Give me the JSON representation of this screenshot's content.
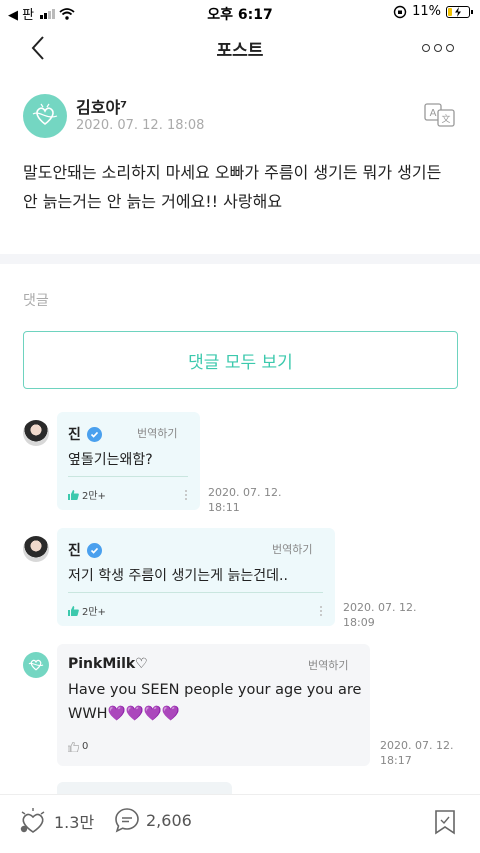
{
  "status_bar": {
    "back_app": "◀ 판",
    "network": "",
    "time": "오후 6:17",
    "battery_text": "11%",
    "battery_level": 0.11,
    "battery_color": "#f2c200"
  },
  "nav": {
    "title": "포스트",
    "back_icon": "chevron-left-icon",
    "more_icon": "more-horizontal-icon"
  },
  "post": {
    "author": "김호야⁷",
    "date": "2020. 07. 12. 18:08",
    "body": "말도안돼는 소리하지 마세요 오빠가 주름이 생기든 뭐가 생기든 안 늙는거는 안 늙는 거에요!! 사랑해요",
    "translate_icon": "translate-icon"
  },
  "comments_section": {
    "label": "댓글",
    "view_all": "댓글 모두 보기"
  },
  "comments": [
    {
      "author": "진",
      "verified": true,
      "translate": "번역하기",
      "text": "옆돌기는왜함?",
      "likes": "2만+",
      "date_line1": "2020. 07. 12.",
      "date_line2": "18:11"
    },
    {
      "author": "진",
      "verified": true,
      "translate": "번역하기",
      "text": "저기 학생 주름이 생기는게 늙는건데..",
      "likes": "2만+",
      "date_line1": "2020. 07. 12.",
      "date_line2": "18:09"
    },
    {
      "author": "PinkMilk♡",
      "verified": false,
      "translate": "번역하기",
      "text_line1": "Have you SEEN people your age you are",
      "text_line2": "WWH",
      "hearts": "💜💜💜💜",
      "likes": "0",
      "date_line1": "2020. 07. 12.",
      "date_line2": "18:17"
    }
  ],
  "bottom_bar": {
    "likes": "1.3만",
    "comments": "2,606",
    "bookmark_icon": "bookmark-icon"
  },
  "colors": {
    "accent": "#3cc9ad",
    "artist_bubble": "#eef9fb",
    "fan_bubble": "#f5f6f8",
    "verified": "#4aa0ee",
    "like_active": "#3cc9ad"
  }
}
